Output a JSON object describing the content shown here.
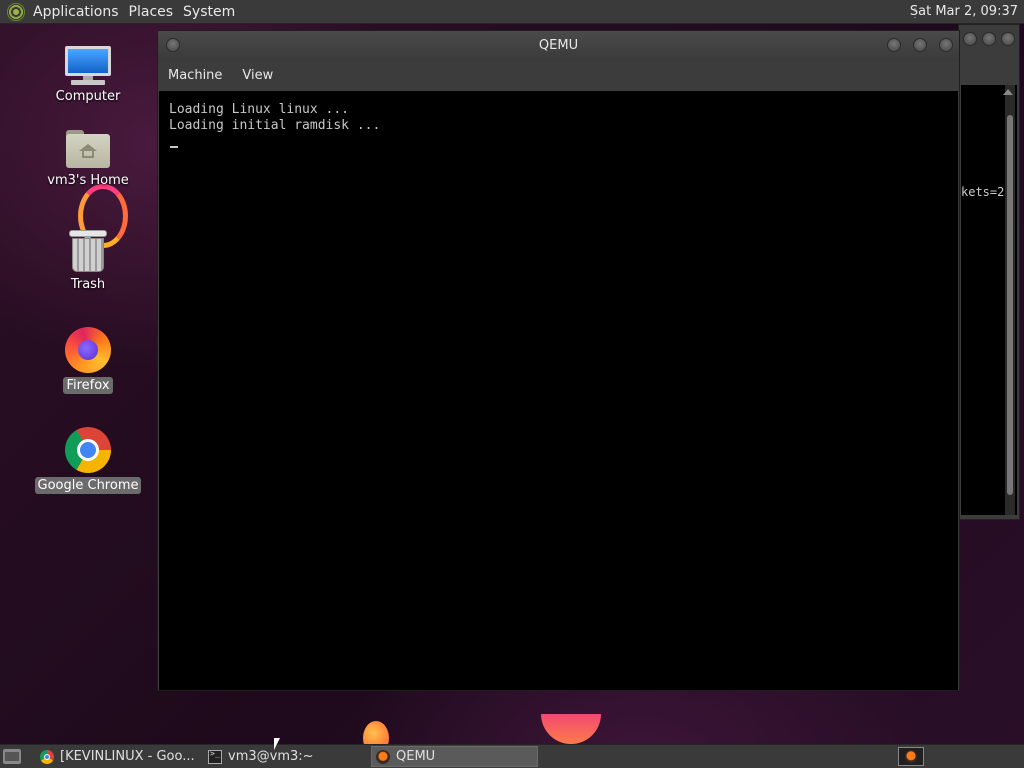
{
  "top_panel": {
    "menus": [
      "Applications",
      "Places",
      "System"
    ],
    "clock": "Sat Mar  2, 09:37"
  },
  "desktop": {
    "icons": [
      {
        "label": "Computer",
        "icon": "computer-icon"
      },
      {
        "label": "vm3's Home",
        "icon": "home-folder-icon"
      },
      {
        "label": "Trash",
        "icon": "trash-icon"
      },
      {
        "label": "Firefox",
        "icon": "firefox-icon"
      },
      {
        "label": "Google Chrome",
        "icon": "chrome-icon"
      }
    ]
  },
  "qemu_window": {
    "title": "QEMU",
    "menu": [
      "Machine",
      "View"
    ],
    "console_lines": [
      "Loading Linux linux ...",
      "Loading initial ramdisk ..."
    ]
  },
  "background_window": {
    "visible_text": "kets=2"
  },
  "taskbar": {
    "tasks": [
      {
        "label": "[KEVINLINUX - Goo...",
        "icon": "chrome-icon",
        "active": false
      },
      {
        "label": "vm3@vm3:~",
        "icon": "terminal-icon",
        "active": false
      },
      {
        "label": "QEMU",
        "icon": "qemu-icon",
        "active": true
      }
    ]
  },
  "colors": {
    "panel": "#3a3a3a",
    "console_bg": "#000000",
    "console_text": "#c8c8c8"
  }
}
